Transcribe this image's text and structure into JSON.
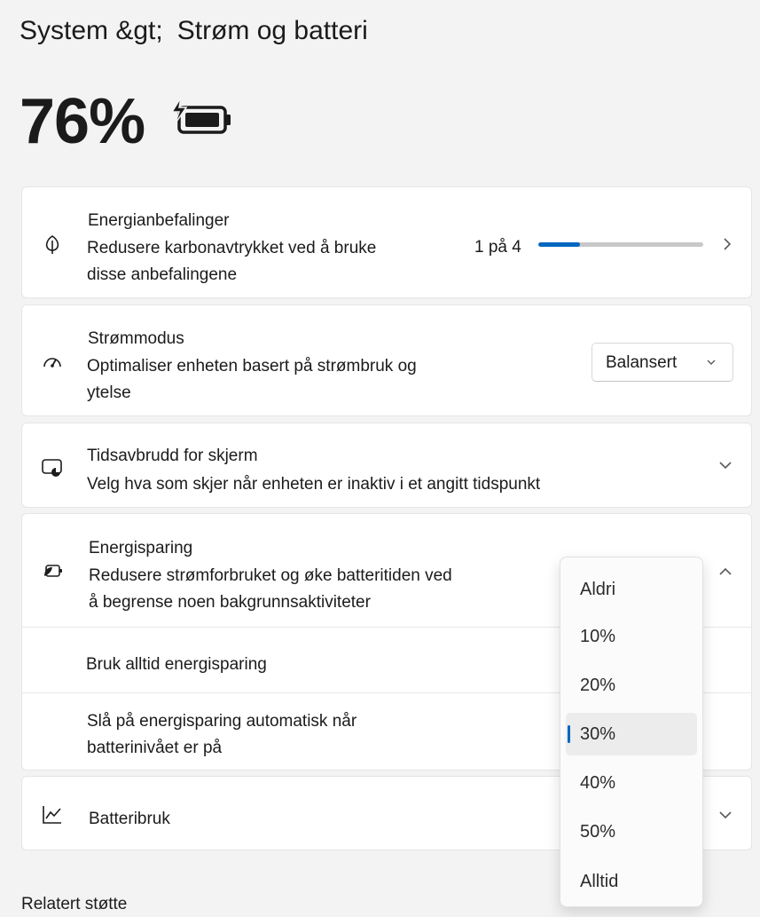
{
  "breadcrumb": {
    "parent": "System &gt;",
    "current": "Strøm og batteri"
  },
  "battery": {
    "level": "76%",
    "icon": "battery-charging-icon"
  },
  "recommendations": {
    "icon": "leaf-icon",
    "title": "Energianbefalinger",
    "description": "Redusere karbonavtrykket ved å bruke disse anbefalingene",
    "progress_text": "1 på 4",
    "progress_fraction": 0.25,
    "accent": "#0067c0"
  },
  "power_mode": {
    "icon": "gauge-icon",
    "title": "Strømmodus",
    "description": "Optimaliser enheten basert på strømbruk og ytelse",
    "selected": "Balansert"
  },
  "screen_timeout": {
    "icon": "screen-timeout-icon",
    "title": "Tidsavbrudd for skjerm",
    "description": "Velg hva som skjer når enheten er inaktiv i et angitt tidspunkt"
  },
  "energy_saver": {
    "icon": "energy-saver-icon",
    "title": "Energisparing",
    "description": "Redusere strømforbruket og øke batteritiden ved å begrense noen bakgrunnsaktiviteter",
    "always_label": "Bruk alltid energisparing",
    "auto_label": "Slå på energisparing automatisk når batterinivået er på"
  },
  "battery_usage": {
    "icon": "chart-icon",
    "title": "Batteribruk"
  },
  "threshold_menu": {
    "options": [
      "Aldri",
      "10%",
      "20%",
      "30%",
      "40%",
      "50%",
      "Alltid"
    ],
    "selected": "30%"
  },
  "related_support": "Relatert støtte"
}
